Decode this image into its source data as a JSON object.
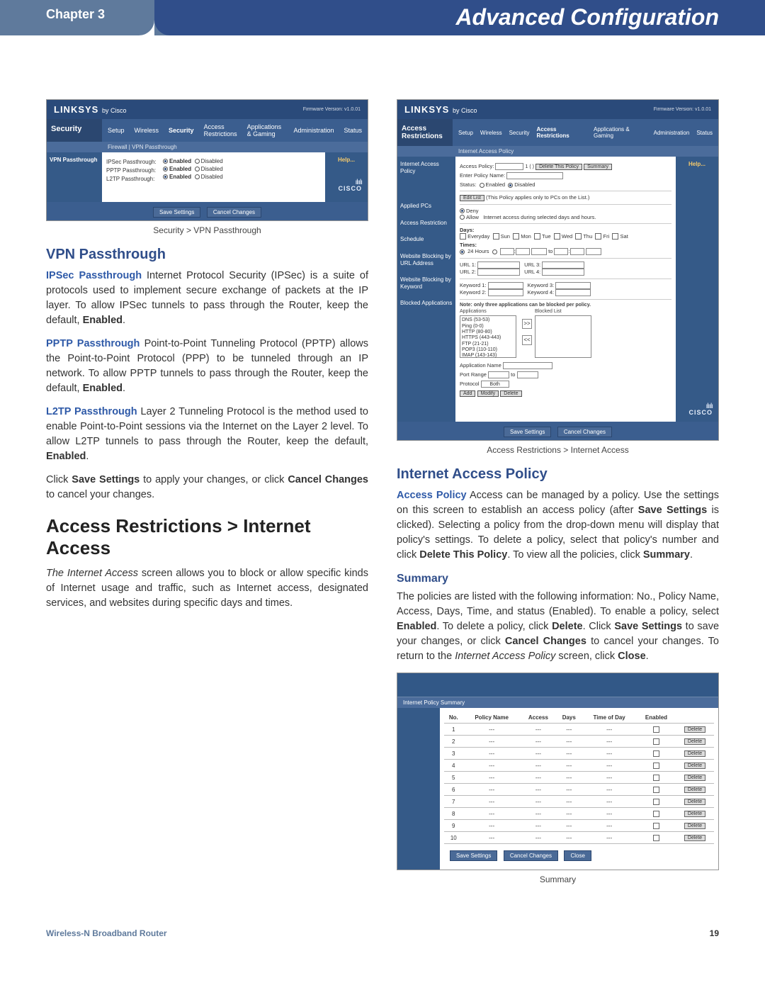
{
  "header": {
    "chapter": "Chapter 3",
    "title": "Advanced Configuration"
  },
  "fig1": {
    "logo": "LINKSYS",
    "logo_by": "by Cisco",
    "fw": "Firmware Version: v1.0.01",
    "sideTitle": "Security",
    "tabs": [
      "Setup",
      "Wireless",
      "Security",
      "Access Restrictions",
      "Applications & Gaming",
      "Administration",
      "Status"
    ],
    "subnav": "Firewall   |   VPN Passthrough",
    "leftTab": "VPN Passthrough",
    "rows": {
      "r1": "IPSec Passthrough:",
      "r2": "PPTP Passthrough:",
      "r3": "L2TP Passthrough:"
    },
    "optEnabled": "Enabled",
    "optDisabled": "Disabled",
    "help": "Help...",
    "cisco_bars": "ılıılı",
    "cisco": "CISCO",
    "btnSave": "Save Settings",
    "btnCancel": "Cancel Changes",
    "caption": "Security > VPN Passthrough"
  },
  "left": {
    "h_vpn": "VPN Passthrough",
    "ipsec_lead": "IPSec Passthrough",
    "ipsec_rest": "  Internet Protocol Security (IPSec) is a suite of protocols used to implement secure exchange of packets at the IP layer. To allow IPSec tunnels to pass through the Router, keep the default, ",
    "ipsec_bold": "Enabled",
    "pptp_lead": "PPTP Passthrough",
    "pptp_rest": " Point-to-Point Tunneling Protocol (PPTP) allows the Point-to-Point Protocol (PPP) to be tunneled through an IP network. To allow PPTP tunnels to pass through the Router, keep the default, ",
    "pptp_bold": "Enabled",
    "l2tp_lead": "L2TP Passthrough",
    "l2tp_rest": " Layer 2 Tunneling Protocol is the method used to enable Point-to-Point sessions via the Internet on the Layer 2 level. To allow L2TP tunnels to pass through the Router, keep the default, ",
    "l2tp_bold": "Enabled",
    "save_a": "Click ",
    "save_b": "Save Settings",
    "save_c": " to apply your changes, or click ",
    "save_d": "Cancel Changes",
    "save_e": " to cancel your changes.",
    "h_access": "Access Restrictions > Internet Access",
    "access_p": "The Internet Access screen allows you to block or allow specific kinds of Internet usage and traffic, such as Internet access, designated services, and websites during specific days and times."
  },
  "fig2": {
    "logo": "LINKSYS",
    "logo_by": "by Cisco",
    "fw": "Firmware Version: v1.0.01",
    "sideTitle": "Access Restrictions",
    "tabs": [
      "Setup",
      "Wireless",
      "Security",
      "Access Restrictions",
      "Applications & Gaming",
      "Administration",
      "Status"
    ],
    "subnav": "Internet Access Policy",
    "left_labels": {
      "a": "Internet Access Policy",
      "b": "Applied PCs",
      "c": "Access Restriction",
      "d": "Schedule",
      "e": "Website Blocking by URL Address",
      "f": "Website Blocking by Keyword",
      "g": "Blocked Applications"
    },
    "policy_label": "Access Policy:",
    "policy_sel": "1 ( )",
    "btn_delpol": "Delete This Policy",
    "btn_summary": "Summary",
    "enter_name": "Enter Policy Name:",
    "status": "Status:",
    "status_en": "Enabled",
    "status_dis": "Disabled",
    "editlist": "Edit List",
    "editlist_hint": "(This Policy applies only to PCs on the List.)",
    "deny": "Deny",
    "allow": "Allow",
    "access_hint": "Internet access during selected days and hours.",
    "days": "Days:",
    "day_every": "Everyday",
    "day_list": [
      "Sun",
      "Mon",
      "Tue",
      "Wed",
      "Thu",
      "Fri",
      "Sat"
    ],
    "times": "Times:",
    "time_24": "24 Hours",
    "url1": "URL 1:",
    "url2": "URL 2:",
    "url3": "URL 3:",
    "url4": "URL 4:",
    "kw1": "Keyword 1:",
    "kw2": "Keyword 2:",
    "kw3": "Keyword 3:",
    "kw4": "Keyword 4:",
    "blocked_note": "Note: only three applications can be blocked per policy.",
    "apps_label": "Applications",
    "blocked_label": "Blocked List",
    "apps_list": "DNS (53-53)\nPing (0-0)\nHTTP (80-80)\nHTTPS (443-443)\nFTP (21-21)\nPOP3 (110-110)\nIMAP (143-143)",
    "arrow_r": ">>",
    "arrow_l": "<<",
    "appname": "Application Name",
    "portrange": "Port Range",
    "to": "to",
    "protocol": "Protocol",
    "both": "Both",
    "btn_add": "Add",
    "btn_modify": "Modify",
    "btn_delete": "Delete",
    "help": "Help...",
    "cisco_bars": "ılıılı",
    "cisco": "CISCO",
    "btnSave": "Save Settings",
    "btnCancel": "Cancel Changes",
    "caption": "Access Restrictions > Internet Access"
  },
  "right": {
    "h_policy": "Internet Access Policy",
    "ap_lead": "Access Policy",
    "ap_a": "   Access can be managed by a policy. Use the settings on this screen to establish an access policy (after ",
    "ap_b": "Save Settings",
    "ap_c": " is clicked). Selecting a policy from the drop-down menu will display that policy's settings. To delete a policy, select that policy's number and click ",
    "ap_d": "Delete This Policy",
    "ap_e": ". To view all the policies, click ",
    "ap_f": "Summary",
    "ap_g": ".",
    "h_summary": "Summary",
    "sum_a": "The policies are listed with the following information: No., Policy Name, Access, Days, Time, and status (Enabled). To enable a policy, select ",
    "sum_b": "Enabled",
    "sum_c": ". To delete a policy, click ",
    "sum_d": "Delete",
    "sum_e": ". Click ",
    "sum_f": "Save Settings",
    "sum_g": " to save your changes, or click ",
    "sum_h": "Cancel Changes",
    "sum_i": " to cancel your changes. To return to the ",
    "sum_j": "Internet Access Policy",
    "sum_k": " screen, click ",
    "sum_l": "Close",
    "sum_m": "."
  },
  "fig3": {
    "subbar": "Internet Policy Summary",
    "headers": [
      "No.",
      "Policy Name",
      "Access",
      "Days",
      "Time of Day",
      "Enabled",
      ""
    ],
    "rows": [
      "1",
      "2",
      "3",
      "4",
      "5",
      "6",
      "7",
      "8",
      "9",
      "10"
    ],
    "dash": "---",
    "del": "Delete",
    "btnSave": "Save Settings",
    "btnCancel": "Cancel Changes",
    "btnClose": "Close",
    "caption": "Summary"
  },
  "footer": {
    "product": "Wireless-N Broadband Router",
    "page": "19"
  }
}
